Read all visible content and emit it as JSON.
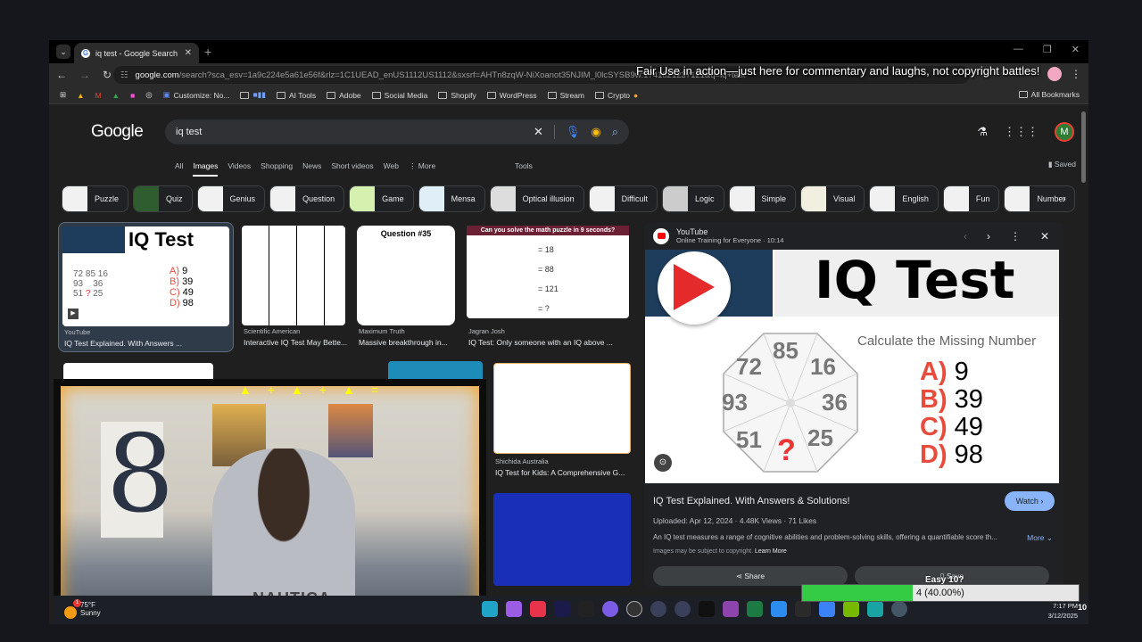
{
  "browser": {
    "tab_title": "iq test - Google Search",
    "url_domain": "google.com",
    "url_path": "/search?sca_esv=1a9c224e5a61e56f&rlz=1C1UEAD_enUS1112US1112&sxsrf=AHTn8zqW-NiXoanot35NJIM_l0lcSYSB9w:1741821237121&q=iq+test",
    "bookmarks": [
      "Customize: No...",
      "",
      "AI Tools",
      "Adobe",
      "Social Media",
      "Shopify",
      "WordPress",
      "Stream",
      "Crypto"
    ],
    "all_bookmarks": "All Bookmarks"
  },
  "overlay_caption": "Fair Use in action—just here for commentary and laughs, not copyright battles!",
  "google": {
    "logo": "Google",
    "query": "iq test",
    "filters": [
      "All",
      "Images",
      "Videos",
      "Shopping",
      "News",
      "Short videos",
      "Web",
      "⋮ More"
    ],
    "active_filter": "Images",
    "tools": "Tools",
    "saved": "Saved",
    "avatar_letter": "M",
    "chips": [
      "Puzzle",
      "Quiz",
      "Genius",
      "Question",
      "Game",
      "Mensa",
      "Optical illusion",
      "Difficult",
      "Logic",
      "Simple",
      "Visual",
      "English",
      "Fun",
      "Number"
    ],
    "results": [
      {
        "source": "YouTube",
        "title": "IQ Test Explained. With Answers ..."
      },
      {
        "source": "Scientific American",
        "title": "Interactive IQ Test May Bette..."
      },
      {
        "source": "Maximum Truth",
        "title": "Massive breakthrough in..."
      },
      {
        "source": "Jagran Josh",
        "title": "IQ Test: Only someone with an IQ above ..."
      },
      {
        "source": "Shichida Australia",
        "title": "IQ Test for Kids: A Comprehensive G..."
      }
    ],
    "thumb_texts": {
      "question": "Question #35",
      "math_puzzle": "Can you solve the math puzzle in 9 seconds?",
      "math_lines": [
        "= 18",
        "= 88",
        "= 121",
        "= ?"
      ]
    }
  },
  "panel": {
    "source": "YouTube",
    "channel": "Online Training for Everyone · 10:14",
    "image": {
      "heading": "IQ Test",
      "subheading": "Calculate the Missing Number",
      "octagon_numbers": [
        "85",
        "16",
        "36",
        "25",
        "?",
        "51",
        "93",
        "72"
      ],
      "options": [
        {
          "k": "A)",
          "v": "9"
        },
        {
          "k": "B)",
          "v": "39"
        },
        {
          "k": "C)",
          "v": "49"
        },
        {
          "k": "D)",
          "v": "98"
        }
      ]
    },
    "title": "IQ Test Explained. With Answers & Solutions!",
    "watch": "Watch ›",
    "meta": "Uploaded: Apr 12, 2024 · 4.48K Views · 71 Likes",
    "description": "An IQ test measures a range of cognitive abilities and problem-solving skills, offering a quantifiable score th...",
    "more": "More ⌄",
    "copyright": "Images may be subject to copyright.",
    "learn_more": "Learn More",
    "share": "Share",
    "save": "Save"
  },
  "webcam": {
    "shirt_text": "NAUTICA"
  },
  "taskbar": {
    "weather_temp": "75°F",
    "weather_cond": "Sunny",
    "weather_badge": "1",
    "time": "7:17 PM",
    "date": "3/12/2025",
    "notif_count": "10"
  },
  "poll": {
    "label": "Easy 10?",
    "value_text": "4 (40.00%)",
    "fraction": 0.4
  }
}
